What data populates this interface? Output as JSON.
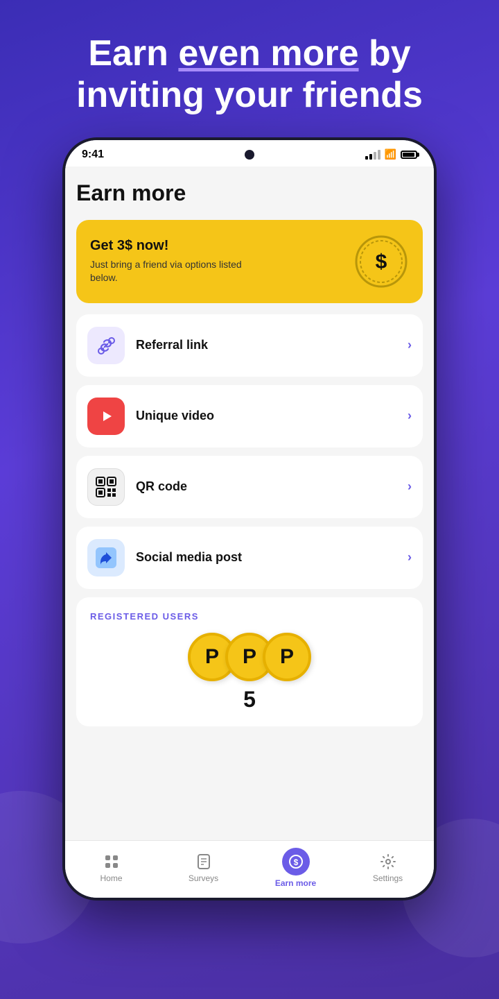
{
  "headline": {
    "line1": "Earn even more by",
    "line2": "inviting your friends",
    "underline_word": "more"
  },
  "status_bar": {
    "time": "9:41",
    "signal": "signal",
    "wifi": "wifi",
    "battery": "battery"
  },
  "page": {
    "title": "Earn more",
    "banner": {
      "title": "Get 3$ now!",
      "subtitle": "Just bring a friend via options listed below."
    },
    "menu_items": [
      {
        "id": "referral",
        "label": "Referral link",
        "icon_type": "link"
      },
      {
        "id": "video",
        "label": "Unique video",
        "icon_type": "play"
      },
      {
        "id": "qr",
        "label": "QR code",
        "icon_type": "qr"
      },
      {
        "id": "social",
        "label": "Social media post",
        "icon_type": "thumbsup"
      }
    ],
    "registered": {
      "section_label": "REGISTERED USERS",
      "count": "5"
    }
  },
  "bottom_nav": {
    "items": [
      {
        "id": "home",
        "label": "Home",
        "active": false
      },
      {
        "id": "surveys",
        "label": "Surveys",
        "active": false
      },
      {
        "id": "earn",
        "label": "Earn more",
        "active": true
      },
      {
        "id": "settings",
        "label": "Settings",
        "active": false
      }
    ]
  }
}
